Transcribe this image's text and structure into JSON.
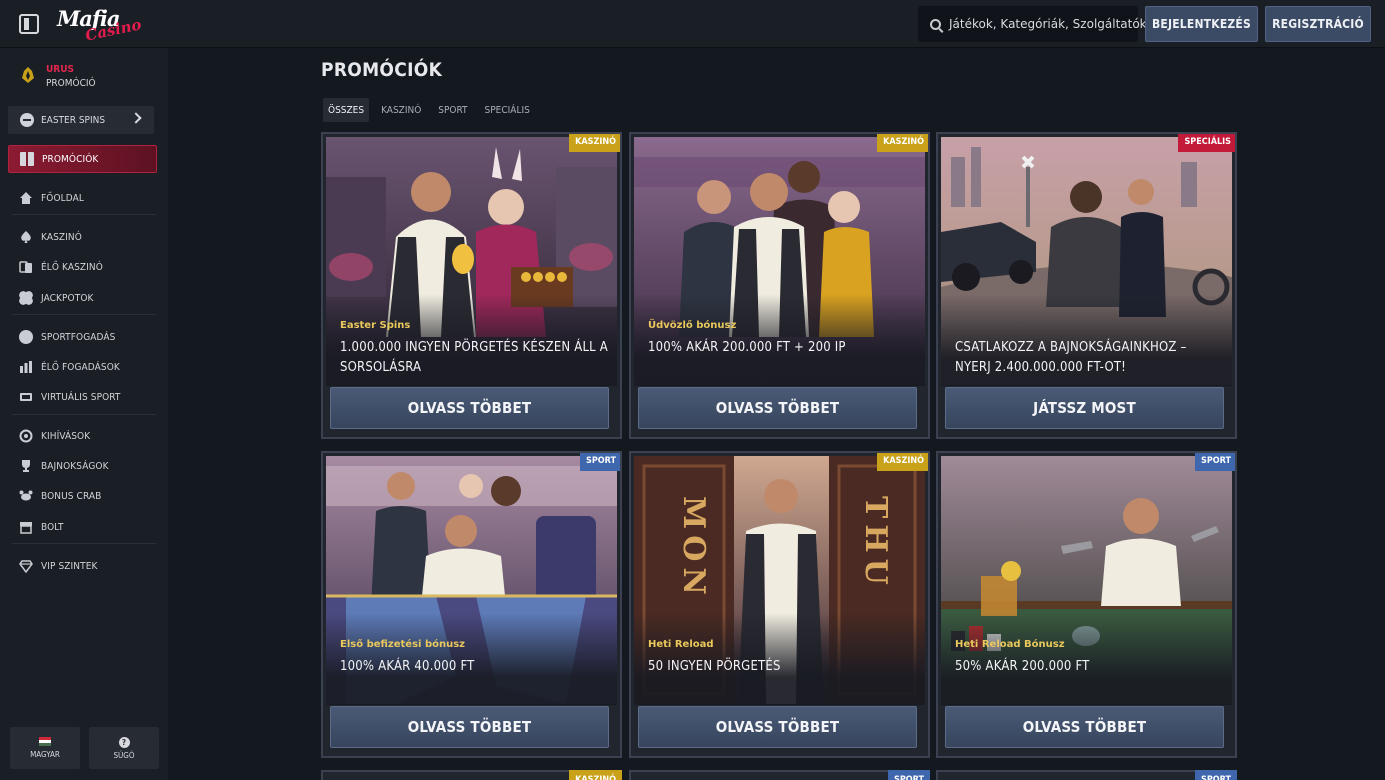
{
  "header": {
    "logo_main": "Mafia",
    "logo_sub": "Casino",
    "search_placeholder": "Játékok, Kategóriák, Szolgáltatók",
    "login_label": "BEJELENTKEZÉS",
    "register_label": "REGISZTRÁCIÓ"
  },
  "sidebar": {
    "promo_line1": "URUS",
    "promo_line2": "PROMÓCIÓ",
    "easter_label": "EASTER SPINS",
    "items": [
      {
        "label": "PROMÓCIÓK",
        "icon": "gift-icon"
      },
      {
        "label": "FŐOLDAL",
        "icon": "home-icon"
      },
      {
        "label": "KASZINÓ",
        "icon": "spade-icon"
      },
      {
        "label": "ÉLŐ KASZINÓ",
        "icon": "live-casino-icon"
      },
      {
        "label": "JACKPOTOK",
        "icon": "clover-icon"
      },
      {
        "label": "SPORTFOGADÁS",
        "icon": "ball-icon"
      },
      {
        "label": "ÉLŐ FOGADÁSOK",
        "icon": "live-betting-icon"
      },
      {
        "label": "VIRTUÁLIS SPORT",
        "icon": "virtual-sport-icon"
      },
      {
        "label": "KIHÍVÁSOK",
        "icon": "challenge-icon"
      },
      {
        "label": "BAJNOKSÁGOK",
        "icon": "trophy-icon"
      },
      {
        "label": "BONUS CRAB",
        "icon": "crab-icon"
      },
      {
        "label": "BOLT",
        "icon": "shop-icon"
      },
      {
        "label": "VIP SZINTEK",
        "icon": "diamond-icon"
      }
    ],
    "language_label": "MAGYAR",
    "help_label": "SÚGÓ"
  },
  "main": {
    "title": "PROMÓCIÓK",
    "tabs": [
      "ÖSSZES",
      "KASZINÓ",
      "SPORT",
      "SPECIÁLIS"
    ],
    "cards": [
      {
        "badge": "KASZINÓ",
        "subtitle": "Easter Spins",
        "title": "1.000.000 INGYEN PÖRGETÉS KÉSZEN ÁLL A SORSOLÁSRA",
        "button": "OLVASS TÖBBET"
      },
      {
        "badge": "KASZINÓ",
        "subtitle": "Üdvözlő bónusz",
        "title": "100% AKÁR 200.000 FT + 200 IP",
        "button": "OLVASS TÖBBET"
      },
      {
        "badge": "SPECIÁLIS",
        "subtitle": "",
        "title": "CSATLAKOZZ A BAJNOKSÁGAINKHOZ – NYERJ 2.400.000.000 FT-OT!",
        "button": "JÁTSSZ MOST"
      },
      {
        "badge": "SPORT",
        "subtitle": "Első befizetési bónusz",
        "title": "100% AKÁR 40.000 FT",
        "button": "OLVASS TÖBBET"
      },
      {
        "badge": "KASZINÓ",
        "subtitle": "Heti Reload",
        "title": "50 INGYEN PÖRGETÉS",
        "button": "OLVASS TÖBBET"
      },
      {
        "badge": "SPORT",
        "subtitle": "Heti Reload Bónusz",
        "title": "50% AKÁR 200.000 FT",
        "button": "OLVASS TÖBBET"
      }
    ],
    "peek_badges": [
      "KASZINÓ",
      "SPORT",
      "SPORT"
    ],
    "door_letters_left": "MON",
    "door_letters_right": "THU"
  },
  "colors": {
    "accent_red": "#c31a3a",
    "badge_kaszino": "#c9a21a",
    "badge_sport": "#3e67ad",
    "button_blue": "#3b4b66"
  }
}
